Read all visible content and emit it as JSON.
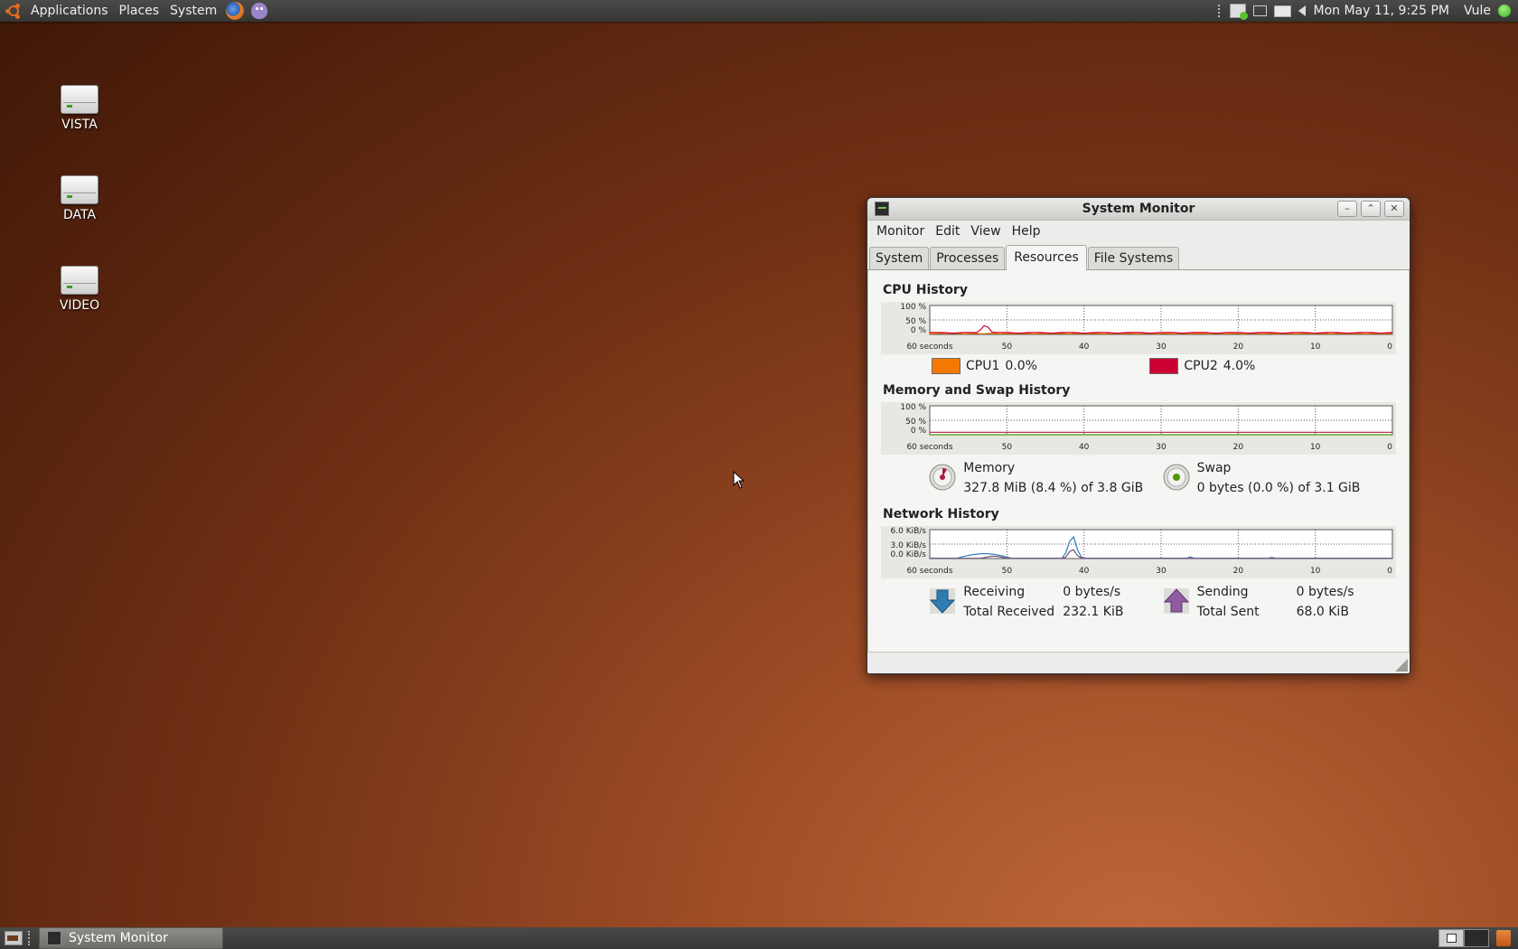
{
  "top_panel": {
    "menus": [
      "Applications",
      "Places",
      "System"
    ],
    "clock": "Mon May 11,  9:25 PM",
    "user": "Vule"
  },
  "desktop_icons": [
    {
      "label": "VISTA",
      "icon": "drive-icon"
    },
    {
      "label": "DATA",
      "icon": "drive-icon"
    },
    {
      "label": "VIDEO",
      "icon": "drive-icon"
    }
  ],
  "window": {
    "title": "System Monitor",
    "menus": [
      "Monitor",
      "Edit",
      "View",
      "Help"
    ],
    "tabs": [
      {
        "label": "System",
        "active": false
      },
      {
        "label": "Processes",
        "active": false
      },
      {
        "label": "Resources",
        "active": true
      },
      {
        "label": "File Systems",
        "active": false
      }
    ],
    "x_ticks": [
      "60 seconds",
      "50",
      "40",
      "30",
      "20",
      "10",
      "0"
    ],
    "cpu": {
      "title": "CPU History",
      "y_ticks": [
        "100 %",
        "50 %",
        "0 %"
      ],
      "series": [
        {
          "label": "CPU1",
          "value": "0.0%",
          "color": "#f57900"
        },
        {
          "label": "CPU2",
          "value": "4.0%",
          "color": "#cc0033"
        }
      ]
    },
    "memory": {
      "title": "Memory and Swap History",
      "y_ticks": [
        "100 %",
        "50 %",
        "0 %"
      ],
      "memory_label": "Memory",
      "memory_value": "327.8 MiB (8.4 %) of 3.8 GiB",
      "memory_fraction": 0.084,
      "swap_label": "Swap",
      "swap_value": "0 bytes (0.0 %) of 3.1 GiB",
      "swap_fraction": 0.0,
      "memory_color": "#ad1f40",
      "swap_color": "#4e9a06"
    },
    "network": {
      "title": "Network History",
      "y_ticks": [
        "6.0 KiB/s",
        "3.0 KiB/s",
        "0.0 KiB/s"
      ],
      "receiving_label": "Receiving",
      "receiving_value": "0 bytes/s",
      "total_received_label": "Total Received",
      "total_received_value": "232.1 KiB",
      "sending_label": "Sending",
      "sending_value": "0 bytes/s",
      "total_sent_label": "Total Sent",
      "total_sent_value": "68.0 KiB",
      "receiving_color": "#2d7db3",
      "sending_color": "#75507b"
    }
  },
  "bottom_panel": {
    "task": "System Monitor"
  }
}
